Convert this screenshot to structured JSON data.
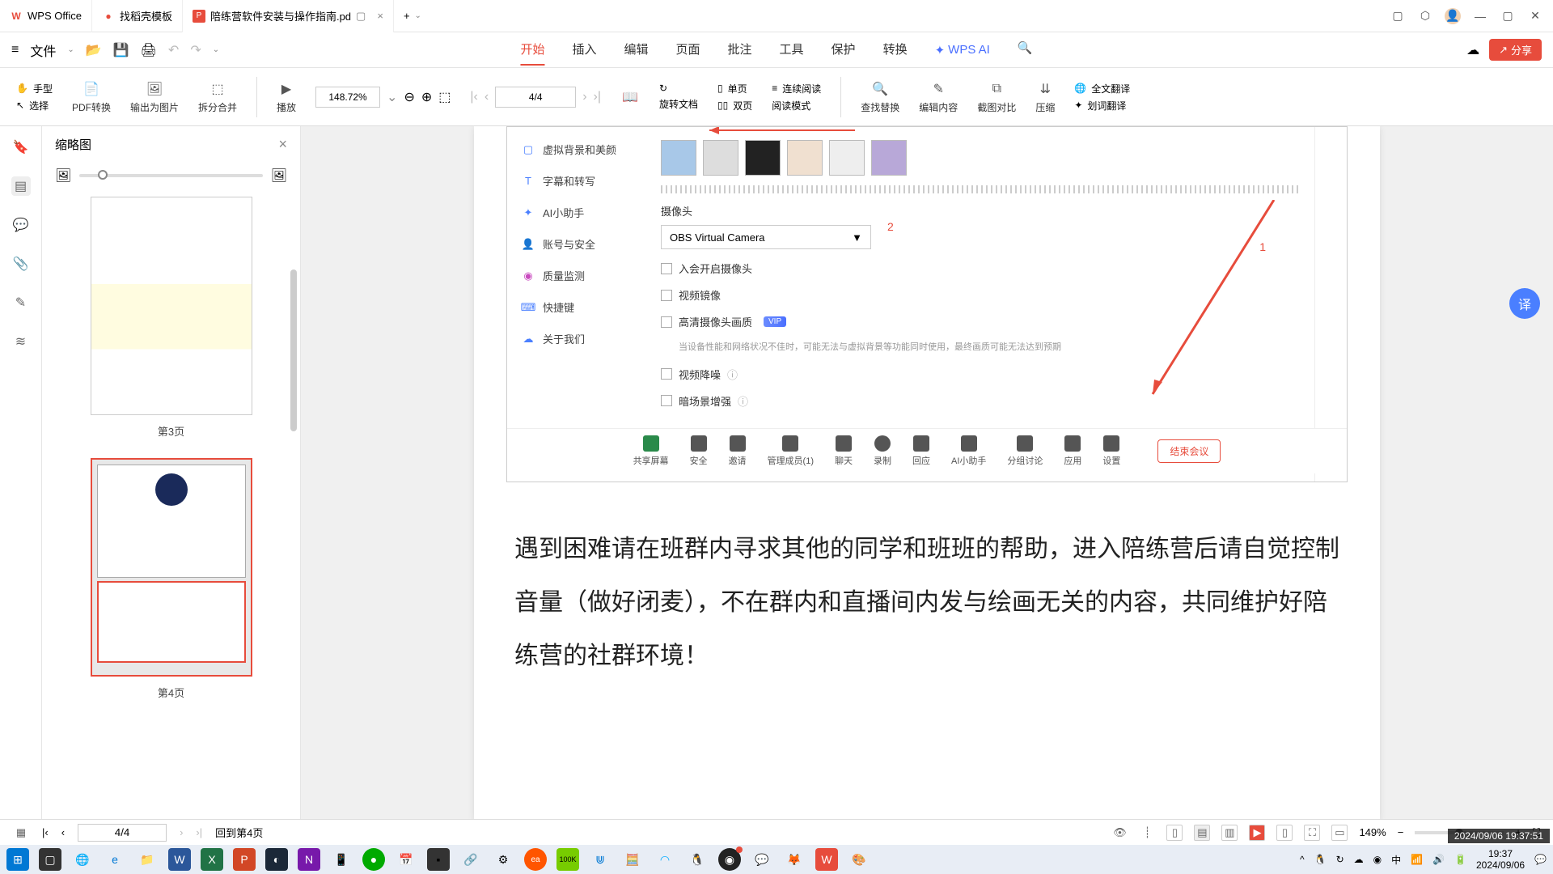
{
  "titlebar": {
    "tabs": [
      {
        "icon": "W",
        "iconColor": "#e74c3c",
        "label": "WPS Office"
      },
      {
        "icon": "●",
        "iconColor": "#e74c3c",
        "label": "找稻壳模板"
      },
      {
        "icon": "P",
        "iconColor": "#e74c3c",
        "label": "陪练营软件安装与操作指南.pd"
      }
    ],
    "addTab": "+"
  },
  "menubar": {
    "fileLabel": "文件",
    "tabs": [
      "开始",
      "插入",
      "编辑",
      "页面",
      "批注",
      "工具",
      "保护",
      "转换"
    ],
    "activeTab": "开始",
    "wpsAi": "WPS AI",
    "share": "分享"
  },
  "toolbar": {
    "hand": "手型",
    "select": "选择",
    "pdfConvert": "PDF转换",
    "exportImg": "输出为图片",
    "splitMerge": "拆分合并",
    "play": "播放",
    "zoomValue": "148.72%",
    "rotate": "旋转文档",
    "singlePage": "单页",
    "doublePage": "双页",
    "continuousRead": "连续阅读",
    "readMode": "阅读模式",
    "pageValue": "4/4",
    "findReplace": "查找替换",
    "editContent": "编辑内容",
    "screenshotCompare": "截图对比",
    "compress": "压缩",
    "fullTranslate": "全文翻译",
    "wordTranslate": "划词翻译"
  },
  "thumbnails": {
    "title": "缩略图",
    "pages": [
      "第3页",
      "第4页"
    ]
  },
  "embed": {
    "sideMenu": [
      {
        "icon": "▢",
        "color": "#4a7fff",
        "label": "虚拟背景和美颜"
      },
      {
        "icon": "T",
        "color": "#4a7fff",
        "label": "字幕和转写"
      },
      {
        "icon": "✦",
        "color": "#4a7fff",
        "label": "AI小助手"
      },
      {
        "icon": "👤",
        "color": "#4a7fff",
        "label": "账号与安全"
      },
      {
        "icon": "◉",
        "color": "#c94abf",
        "label": "质量监测"
      },
      {
        "icon": "⌨",
        "color": "#4a7fff",
        "label": "快捷键"
      },
      {
        "icon": "☁",
        "color": "#4a7fff",
        "label": "关于我们"
      }
    ],
    "cameraLabel": "摄像头",
    "cameraValue": "OBS Virtual Camera",
    "opt1": "入会开启摄像头",
    "opt2": "视频镜像",
    "opt3": "高清摄像头画质",
    "opt3Hint": "当设备性能和网络状况不佳时，可能无法与虚拟背景等功能同时使用，最终画质可能无法达到预期",
    "opt4": "视频降噪",
    "opt5": "暗场景增强",
    "num1": "1",
    "num2": "2",
    "bottomBtns": [
      "共享屏幕",
      "安全",
      "邀请",
      "管理成员(1)",
      "聊天",
      "录制",
      "回应",
      "AI小助手",
      "分组讨论",
      "应用",
      "设置"
    ],
    "endMeeting": "结束会议"
  },
  "bodyText": "遇到困难请在班群内寻求其他的同学和班班的帮助，进入陪练营后请自觉控制音量（做好闭麦），不在群内和直播间内发与绘画无关的内容，共同维护好陪练营的社群环境！",
  "statusbar": {
    "pageNav": "4/4",
    "backTo": "回到第4页",
    "zoomPct": "149%"
  },
  "taskbar": {
    "time": "19:37",
    "date": "2024/09/06",
    "ime": "中",
    "timestamp": "2024/09/06 19:37:51"
  }
}
